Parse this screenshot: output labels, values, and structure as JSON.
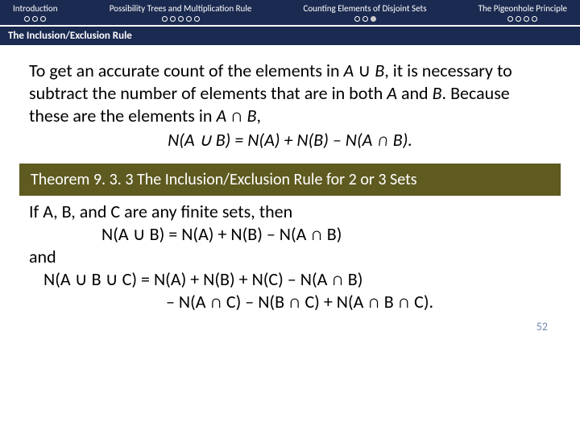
{
  "nav": {
    "items": [
      {
        "title": "Introduction",
        "dots": [
          "o",
          "o",
          "o"
        ]
      },
      {
        "title": "Possibility Trees and Multiplication Rule",
        "dots": [
          "o",
          "o",
          "o",
          "o",
          "o"
        ]
      },
      {
        "title": "Counting Elements of Disjoint Sets",
        "dots": [
          "o",
          "o",
          "f"
        ]
      },
      {
        "title": "The Pigeonhole Principle",
        "dots": [
          "o",
          "o",
          "o",
          "o"
        ]
      }
    ]
  },
  "section_title": "The Inclusion/Exclusion Rule",
  "paragraph": {
    "p1a": "To get an accurate count of the elements in ",
    "p1b": "A",
    "p1c": " ∪ ",
    "p1d": "B",
    "p1e": ", it is necessary to subtract the number of elements that are in both ",
    "p1f": "A",
    "p1g": " and ",
    "p1h": "B",
    "p1i": ". Because these are the elements in ",
    "p1j": "A",
    "p1k": " ∩ ",
    "p1l": "B",
    "p1m": ","
  },
  "equation1": "N(A ∪ B) = N(A) + N(B) – N(A ∩ B).",
  "theorem_label": "Theorem 9. 3. 3 The Inclusion/Exclusion Rule for 2 or 3 Sets",
  "body2": {
    "line1a": "If ",
    "line1b": "A",
    "line1c": ", ",
    "line1d": "B",
    "line1e": ", and ",
    "line1f": "C",
    "line1g": " are any finite sets, then",
    "eq2": "N(A ∪ B) = N(A) + N(B) – N(A ∩ B)",
    "and": "and",
    "eq3": "N(A ∪ B ∪ C) = N(A) + N(B) + N(C) – N(A ∩ B)",
    "eq3b": "– N(A ∩ C) – N(B ∩ C) + N(A ∩ B ∩ C)."
  },
  "page_number": "52"
}
